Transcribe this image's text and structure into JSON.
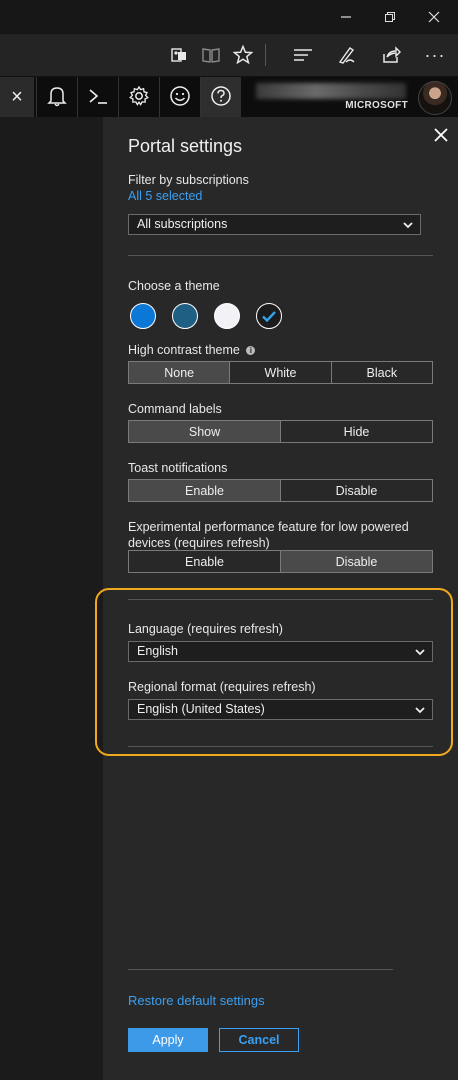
{
  "window": {
    "minimize_icon": "minimize-icon",
    "restore_icon": "restore-icon",
    "close_icon": "close-icon"
  },
  "browser_toolbar": {
    "icons": [
      "extensions-icon",
      "reading-view-icon",
      "favorite-star-icon",
      "hub-icon",
      "notes-pen-icon",
      "share-icon",
      "more-icon"
    ],
    "more_label": "···"
  },
  "portal_bar": {
    "close_label": "×",
    "buttons": [
      "notifications-icon",
      "cloud-shell-icon",
      "settings-icon",
      "feedback-smiley-icon",
      "help-icon"
    ],
    "account_org": "MICROSOFT"
  },
  "settings": {
    "title": "Portal settings",
    "filter": {
      "label": "Filter by subscriptions",
      "selected_link": "All 5 selected",
      "dropdown_value": "All subscriptions"
    },
    "theme": {
      "label": "Choose a theme",
      "swatches": [
        {
          "name": "blue",
          "color": "#0b78d7",
          "selected": false
        },
        {
          "name": "azure",
          "color": "#1f5f84",
          "selected": false
        },
        {
          "name": "light",
          "color": "#f2f2f6",
          "selected": false
        },
        {
          "name": "dark",
          "color": "#1c1c1c",
          "selected": true
        }
      ],
      "accent": "#2fa3ee"
    },
    "high_contrast": {
      "label": "High contrast theme",
      "info_icon": "info-icon",
      "options": [
        "None",
        "White",
        "Black"
      ],
      "selected": "None"
    },
    "command_labels": {
      "label": "Command labels",
      "options": [
        "Show",
        "Hide"
      ],
      "selected": "Show"
    },
    "toast": {
      "label": "Toast notifications",
      "options": [
        "Enable",
        "Disable"
      ],
      "selected": "Enable"
    },
    "experimental": {
      "label_line1": "Experimental performance feature for low powered",
      "label_line2": "devices (requires refresh)",
      "options": [
        "Enable",
        "Disable"
      ],
      "selected": "Disable"
    },
    "language": {
      "label": "Language (requires refresh)",
      "value": "English"
    },
    "regional": {
      "label": "Regional format (requires refresh)",
      "value": "English (United States)"
    },
    "restore_link": "Restore default settings",
    "apply_label": "Apply",
    "cancel_label": "Cancel",
    "highlight_color": "#f0a91d"
  }
}
